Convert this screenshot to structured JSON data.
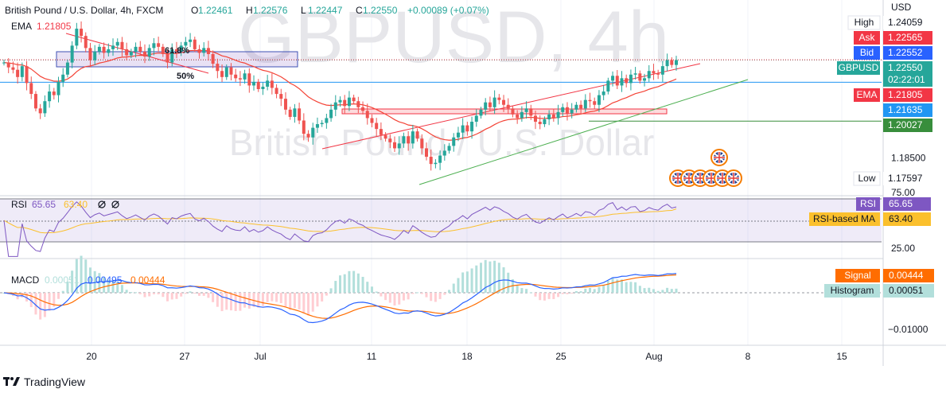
{
  "header": {
    "symbol_line": "British Pound / U.S. Dollar, 4h, FXCM",
    "ohlc": [
      {
        "k": "O",
        "v": "1.22461"
      },
      {
        "k": "H",
        "v": "1.22576"
      },
      {
        "k": "L",
        "v": "1.22447"
      },
      {
        "k": "C",
        "v": "1.22550"
      }
    ],
    "change": "+0.00089 (+0.07%)",
    "ema_label": "EMA",
    "ema_value": "1.21805"
  },
  "watermark": {
    "big": "GBPUSD, 4h",
    "small": "British Pound / U.S. Dollar"
  },
  "price_axis": {
    "currency": "USD",
    "ticks": [
      {
        "label": "1.18500",
        "price": 1.185
      }
    ],
    "badges": [
      {
        "name": "high-label",
        "label": "High",
        "value": "1.24059",
        "price": 1.24059,
        "label_bg": "#ffffff",
        "label_fg": "#131722",
        "value_bg": "#ffffff",
        "value_fg": "#131722"
      },
      {
        "name": "ask-label",
        "label": "Ask",
        "value": "1.22565",
        "price": 1.22565,
        "label_bg": "#f23645",
        "label_fg": "#ffffff",
        "value_bg": "#f23645",
        "value_fg": "#ffffff"
      },
      {
        "name": "bid-label",
        "label": "Bid",
        "value": "1.22552",
        "price": 1.22552,
        "label_bg": "#2962ff",
        "label_fg": "#ffffff",
        "value_bg": "#2962ff",
        "value_fg": "#ffffff"
      },
      {
        "name": "gbpusd-label",
        "label": "GBPUSD",
        "value": "1.22550",
        "price": 1.2255,
        "label_bg": "#26a69a",
        "label_fg": "#ffffff",
        "value_bg": "#26a69a",
        "value_fg": "#ffffff",
        "countdown": "02:22:01"
      },
      {
        "name": "ema-label",
        "label": "EMA",
        "value": "1.21805",
        "price": 1.21805,
        "label_bg": "#f23645",
        "label_fg": "#ffffff",
        "value_bg": "#f23645",
        "value_fg": "#ffffff"
      },
      {
        "name": "level-label-1",
        "label": "",
        "value": "1.21635",
        "price": 1.21635,
        "label_bg": "",
        "label_fg": "",
        "value_bg": "#2196f3",
        "value_fg": "#ffffff"
      },
      {
        "name": "level-label-2",
        "label": "",
        "value": "1.20027",
        "price": 1.20027,
        "label_bg": "",
        "label_fg": "",
        "value_bg": "#388e3c",
        "value_fg": "#ffffff"
      },
      {
        "name": "low-label",
        "label": "Low",
        "value": "1.17597",
        "price": 1.17597,
        "label_bg": "#ffffff",
        "label_fg": "#131722",
        "value_bg": "#ffffff",
        "value_fg": "#131722"
      }
    ]
  },
  "fib": {
    "upper": "61.8%",
    "lower": "50%"
  },
  "rsi": {
    "title": "RSI",
    "value": "65.65",
    "ma_value": "63.40",
    "upper": "75.00",
    "lower": "25.00",
    "badge_label": "RSI",
    "ma_label": "RSI-based MA"
  },
  "macd": {
    "title": "MACD",
    "hist_value": "0.00051",
    "macd_value": "0.00495",
    "signal_value": "0.00444",
    "signal_label": "Signal",
    "hist_label": "Histogram",
    "axis_tick": "−0.01000"
  },
  "time_axis": {
    "ticks": [
      {
        "label": "20",
        "x": 115
      },
      {
        "label": "27",
        "x": 232
      },
      {
        "label": "Jul",
        "x": 327
      },
      {
        "label": "11",
        "x": 467
      },
      {
        "label": "18",
        "x": 587
      },
      {
        "label": "25",
        "x": 705
      },
      {
        "label": "Aug",
        "x": 822
      },
      {
        "label": "8",
        "x": 940
      },
      {
        "label": "15",
        "x": 1058
      }
    ]
  },
  "branding": {
    "name": "TradingView"
  },
  "colors": {
    "up": "#26a69a",
    "down": "#ef5350",
    "ema": "#f44336",
    "rsi": "#7e57c2",
    "rsi_ma": "#fbc02d",
    "macd": "#2962ff",
    "signal": "#ff6d00"
  },
  "chart_data": [
    {
      "type": "candlestick",
      "title": "British Pound / U.S. Dollar, 4h, FXCM",
      "x_ticks": [
        "20",
        "27",
        "Jul",
        "11",
        "18",
        "25",
        "Aug",
        "8",
        "15"
      ],
      "ylim": [
        1.172,
        1.245
      ],
      "last": {
        "open": 1.22461,
        "high": 1.22576,
        "low": 1.22447,
        "close": 1.2255
      },
      "high": 1.24059,
      "low": 1.17597,
      "levels": [
        1.21635,
        1.20027
      ],
      "ema": 1.21805,
      "candles_close": [
        1.2245,
        1.2225,
        1.2215,
        1.2185,
        1.223,
        1.216,
        1.2115,
        1.2055,
        1.2035,
        1.2085,
        1.2125,
        1.211,
        1.2165,
        1.2195,
        1.2245,
        1.2315,
        1.2385,
        1.2355,
        1.2305,
        1.2255,
        1.229,
        1.231,
        1.2285,
        1.23,
        1.2315,
        1.233,
        1.23,
        1.2275,
        1.229,
        1.231,
        1.229,
        1.227,
        1.2305,
        1.2325,
        1.231,
        1.228,
        1.2245,
        1.23,
        1.229,
        1.2315,
        1.233,
        1.234,
        1.23,
        1.2285,
        1.2305,
        1.228,
        1.224,
        1.221,
        1.2185,
        1.2225,
        1.2195,
        1.218,
        1.2175,
        1.22,
        1.215,
        1.2165,
        1.2135,
        1.2145,
        1.217,
        1.214,
        1.2115,
        1.2095,
        1.205,
        1.202,
        1.2055,
        1.2005,
        1.195,
        1.1935,
        1.1975,
        1.199,
        1.1995,
        1.2015,
        1.205,
        1.208,
        1.209,
        1.2065,
        1.21,
        1.2085,
        1.206,
        1.2045,
        1.2015,
        1.1995,
        1.197,
        1.1945,
        1.193,
        1.1915,
        1.189,
        1.191,
        1.194,
        1.191,
        1.196,
        1.193,
        1.189,
        1.1855,
        1.1825,
        1.183,
        1.186,
        1.188,
        1.19,
        1.1935,
        1.1955,
        1.1985,
        1.196,
        1.2,
        1.2025,
        1.205,
        1.208,
        1.206,
        1.21,
        1.209,
        1.207,
        1.2055,
        1.203,
        1.2015,
        1.204,
        1.2055,
        1.2025,
        1.2,
        1.199,
        1.201,
        1.203,
        1.2015,
        1.204,
        1.206,
        1.2035,
        1.205,
        1.207,
        1.2055,
        1.209,
        1.2085,
        1.207,
        1.211,
        1.2125,
        1.217,
        1.219,
        1.215,
        1.218,
        1.216,
        1.2195,
        1.22,
        1.217,
        1.218,
        1.221,
        1.22,
        1.2195,
        1.223,
        1.2255,
        1.2235,
        1.2255
      ],
      "series": [
        {
          "name": "RSI",
          "last": 65.65,
          "ylim": [
            0,
            100
          ],
          "bands": [
            25,
            75
          ]
        },
        {
          "name": "RSI-based MA",
          "last": 63.4
        },
        {
          "name": "MACD",
          "last": 0.00495
        },
        {
          "name": "Signal",
          "last": 0.00444
        },
        {
          "name": "Histogram",
          "last": 0.00051
        }
      ]
    }
  ]
}
